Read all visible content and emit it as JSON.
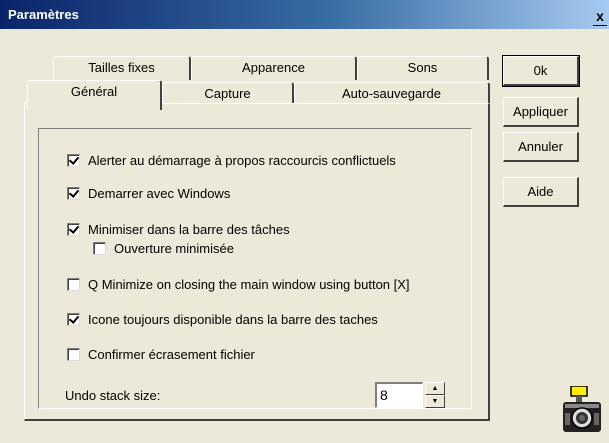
{
  "window": {
    "title": "Paramètres",
    "close_glyph": "x"
  },
  "tabs_back": [
    {
      "label": "Tailles fixes"
    },
    {
      "label": "Apparence"
    },
    {
      "label": "Sons"
    }
  ],
  "tabs_front": [
    {
      "label": "Général",
      "active": true
    },
    {
      "label": "Capture"
    },
    {
      "label": "Auto-sauvegarde"
    }
  ],
  "options": [
    {
      "label": "Alerter au démarrage à propos raccourcis conflictuels",
      "checked": true
    },
    {
      "label": "Demarrer avec Windows",
      "checked": true
    },
    {
      "label": "Minimiser dans la barre des tâches",
      "checked": true
    },
    {
      "label": "Ouverture minimisée",
      "checked": false
    },
    {
      "label": "Q Minimize on closing the main window using button [X]",
      "checked": false
    },
    {
      "label": "Icone toujours disponible dans la barre des taches",
      "checked": true
    },
    {
      "label": "Confirmer écrasement fichier",
      "checked": false
    }
  ],
  "undo": {
    "label": "Undo stack size:",
    "value": "8"
  },
  "buttons": {
    "ok": "0k",
    "apply": "Appliquer",
    "cancel": "Annuler",
    "help": "Aide"
  },
  "colors": {
    "dialog_bg": "#ece9d8",
    "title_start": "#0a246a",
    "title_end": "#a6caf0"
  }
}
